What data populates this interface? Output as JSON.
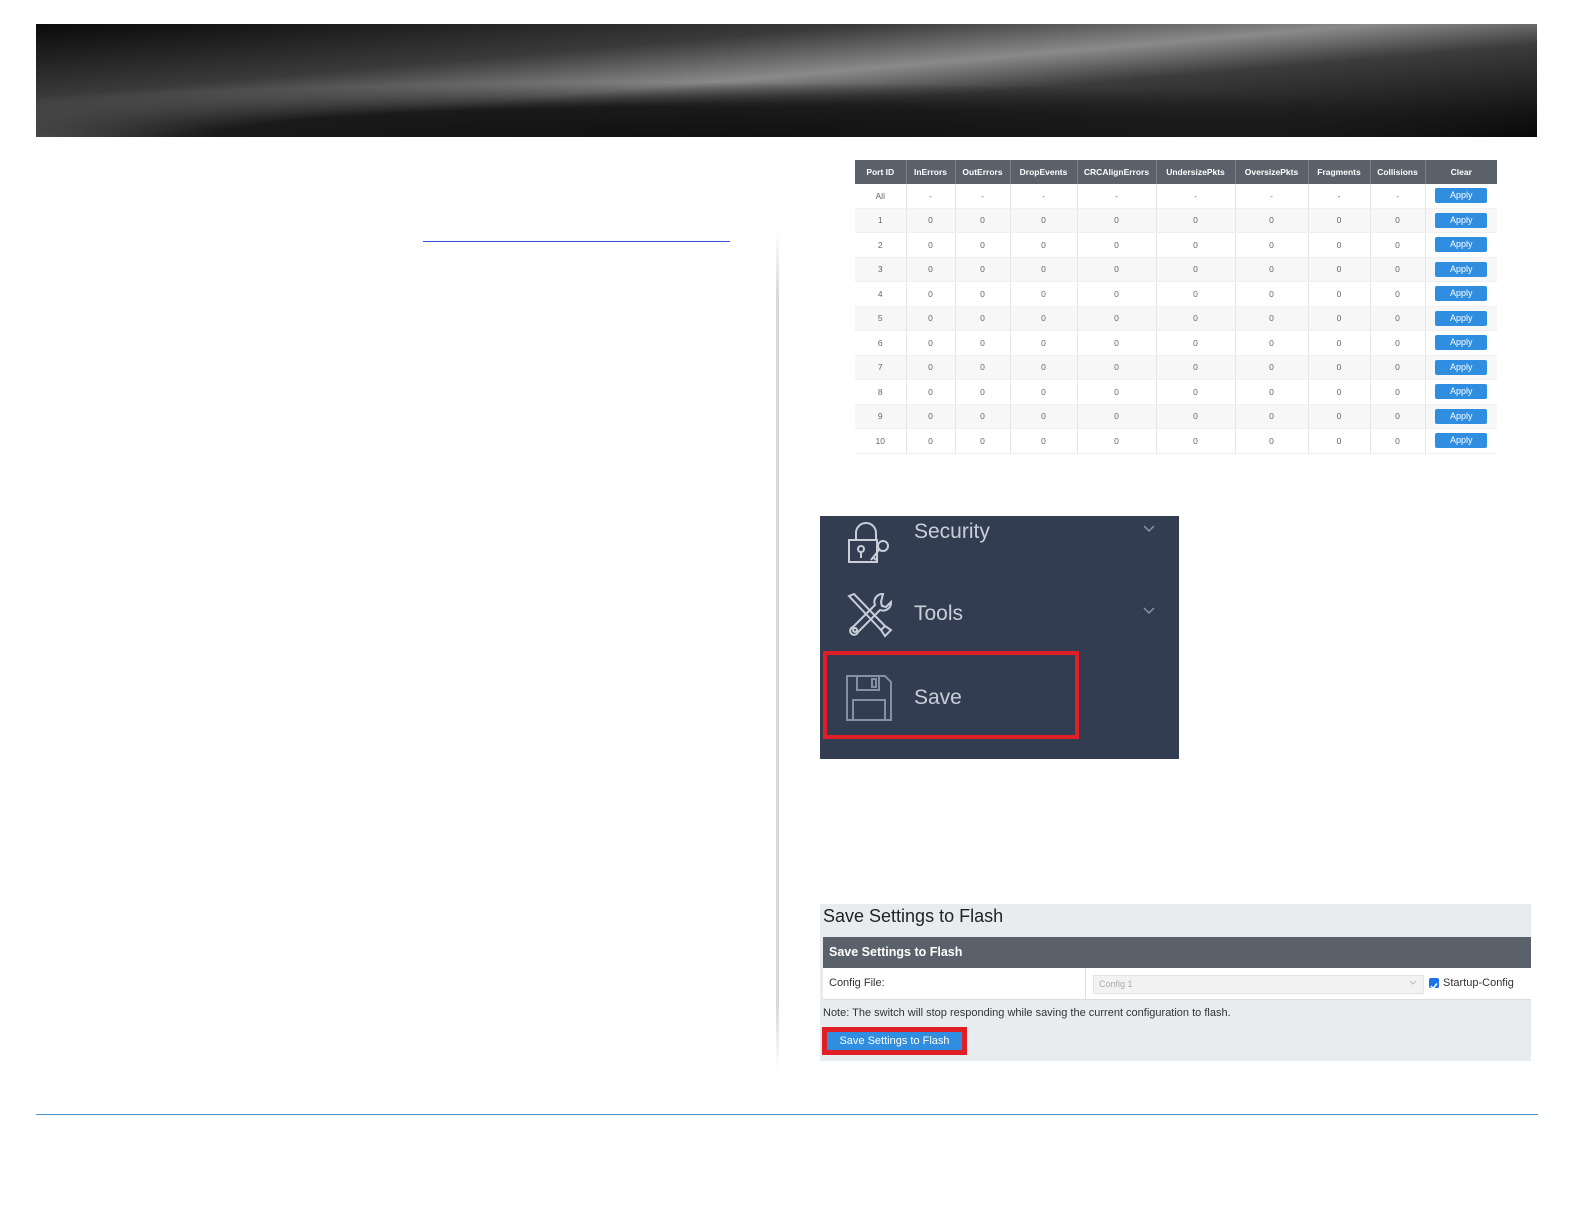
{
  "stats_table": {
    "columns": [
      "Port ID",
      "InErrors",
      "OutErrors",
      "DropEvents",
      "CRCAlignErrors",
      "UndersizePkts",
      "OversizePkts",
      "Fragments",
      "Collisions",
      "Clear"
    ],
    "rows": [
      [
        "All",
        "-",
        "-",
        "-",
        "-",
        "-",
        "-",
        "-",
        "-"
      ],
      [
        "1",
        "0",
        "0",
        "0",
        "0",
        "0",
        "0",
        "0",
        "0"
      ],
      [
        "2",
        "0",
        "0",
        "0",
        "0",
        "0",
        "0",
        "0",
        "0"
      ],
      [
        "3",
        "0",
        "0",
        "0",
        "0",
        "0",
        "0",
        "0",
        "0"
      ],
      [
        "4",
        "0",
        "0",
        "0",
        "0",
        "0",
        "0",
        "0",
        "0"
      ],
      [
        "5",
        "0",
        "0",
        "0",
        "0",
        "0",
        "0",
        "0",
        "0"
      ],
      [
        "6",
        "0",
        "0",
        "0",
        "0",
        "0",
        "0",
        "0",
        "0"
      ],
      [
        "7",
        "0",
        "0",
        "0",
        "0",
        "0",
        "0",
        "0",
        "0"
      ],
      [
        "8",
        "0",
        "0",
        "0",
        "0",
        "0",
        "0",
        "0",
        "0"
      ],
      [
        "9",
        "0",
        "0",
        "0",
        "0",
        "0",
        "0",
        "0",
        "0"
      ],
      [
        "10",
        "0",
        "0",
        "0",
        "0",
        "0",
        "0",
        "0",
        "0"
      ]
    ],
    "apply_label": "Apply"
  },
  "menu": {
    "security_label": "Security",
    "tools_label": "Tools",
    "save_label": "Save"
  },
  "save_panel": {
    "title": "Save Settings to Flash",
    "header": "Save Settings to Flash",
    "config_file_label": "Config File:",
    "config_file_value": "Config 1",
    "startup_config_label": "Startup-Config",
    "startup_config_checked": true,
    "note": "Note: The switch will stop responding while saving the current configuration to flash.",
    "save_button_label": "Save Settings to Flash"
  },
  "colors": {
    "accent_blue": "#2f8ee0",
    "highlight_red": "#e01e26",
    "menu_bg": "#333d52",
    "table_header": "#5a616a"
  }
}
